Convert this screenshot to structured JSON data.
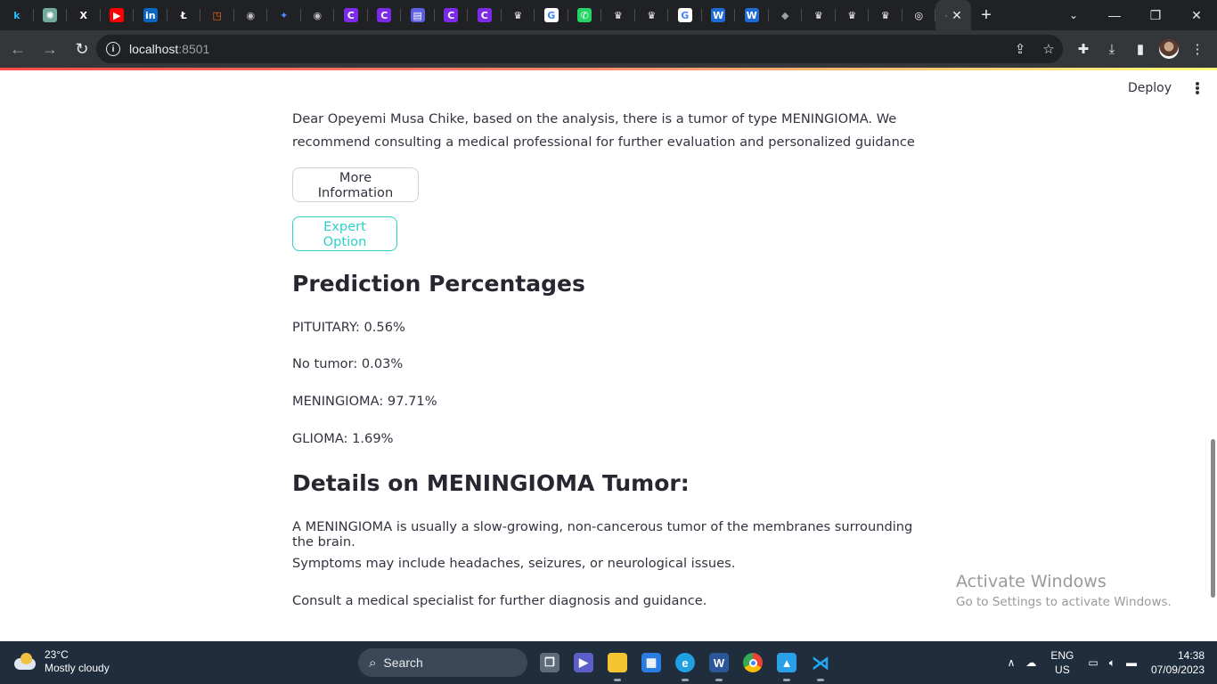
{
  "browser": {
    "tabs": [
      {
        "icon": "kaggle-icon",
        "glyph": "k",
        "color": "#20beff",
        "bg": "transparent"
      },
      {
        "icon": "chatgpt-icon",
        "glyph": "✺",
        "color": "#ffffff",
        "bg": "#74aa9c"
      },
      {
        "icon": "x-icon",
        "glyph": "X",
        "color": "#ffffff",
        "bg": "transparent"
      },
      {
        "icon": "youtube-icon",
        "glyph": "▶",
        "color": "#ffffff",
        "bg": "#ff0000"
      },
      {
        "icon": "linkedin-icon",
        "glyph": "in",
        "color": "#ffffff",
        "bg": "#0a66c2"
      },
      {
        "icon": "upwork-icon",
        "glyph": "Ł",
        "color": "#ffffff",
        "bg": "transparent"
      },
      {
        "icon": "orange-logo-icon",
        "glyph": "◳",
        "color": "#ff6a13",
        "bg": "transparent"
      },
      {
        "icon": "globe-icon",
        "glyph": "◉",
        "color": "#c0c0c0",
        "bg": "transparent"
      },
      {
        "icon": "star-burst-icon",
        "glyph": "✦",
        "color": "#4f8cff",
        "bg": "transparent"
      },
      {
        "icon": "globe-icon",
        "glyph": "◉",
        "color": "#c0c0c0",
        "bg": "transparent"
      },
      {
        "icon": "canva-icon",
        "glyph": "C",
        "color": "#ffffff",
        "bg": "#7d2ae8"
      },
      {
        "icon": "canva-icon",
        "glyph": "C",
        "color": "#ffffff",
        "bg": "#7d2ae8"
      },
      {
        "icon": "app-window-icon",
        "glyph": "▤",
        "color": "#ffffff",
        "bg": "#5b5fe6"
      },
      {
        "icon": "canva-icon",
        "glyph": "C",
        "color": "#ffffff",
        "bg": "#7d2ae8"
      },
      {
        "icon": "canva-icon",
        "glyph": "C",
        "color": "#ffffff",
        "bg": "#7d2ae8"
      },
      {
        "icon": "crown-icon",
        "glyph": "♛",
        "color": "#ffffff",
        "bg": "transparent"
      },
      {
        "icon": "google-icon",
        "glyph": "G",
        "color": "#4285f4",
        "bg": "#ffffff"
      },
      {
        "icon": "whatsapp-icon",
        "glyph": "✆",
        "color": "#ffffff",
        "bg": "#25d366"
      },
      {
        "icon": "crown-icon",
        "glyph": "♛",
        "color": "#ffffff",
        "bg": "transparent"
      },
      {
        "icon": "crown-icon",
        "glyph": "♛",
        "color": "#ffffff",
        "bg": "transparent"
      },
      {
        "icon": "google-icon",
        "glyph": "G",
        "color": "#4285f4",
        "bg": "#ffffff"
      },
      {
        "icon": "webflow-icon",
        "glyph": "W",
        "color": "#ffffff",
        "bg": "#1e6bd6"
      },
      {
        "icon": "webflow-icon",
        "glyph": "W",
        "color": "#ffffff",
        "bg": "#1e6bd6"
      },
      {
        "icon": "layers-icon",
        "glyph": "◆",
        "color": "#9aa0a6",
        "bg": "transparent"
      },
      {
        "icon": "crown-icon",
        "glyph": "♛",
        "color": "#ffffff",
        "bg": "transparent"
      },
      {
        "icon": "crown-icon",
        "glyph": "♛",
        "color": "#ffffff",
        "bg": "transparent"
      },
      {
        "icon": "crown-icon",
        "glyph": "♛",
        "color": "#ffffff",
        "bg": "transparent"
      },
      {
        "icon": "chrome-icon",
        "glyph": "◎",
        "color": "#ffffff",
        "bg": "transparent"
      }
    ],
    "active_tab_glyph": "·",
    "url_host": "localhost",
    "url_port": ":8501"
  },
  "app": {
    "deploy_label": "Deploy",
    "message": "Dear Opeyemi Musa Chike, based on the analysis, there is a tumor of type MENINGIOMA. We recommend consulting a medical professional for further evaluation and personalized guidance",
    "more_info_label": "More Information",
    "expert_option_label": "Expert Option",
    "prediction_heading": "Prediction Percentages",
    "predictions": [
      "PITUITARY: 0.56%",
      "No tumor: 0.03%",
      "MENINGIOMA: 97.71%",
      "GLIOMA: 1.69%"
    ],
    "details_heading": "Details on MENINGIOMA Tumor:",
    "details": [
      "A MENINGIOMA is usually a slow-growing, non-cancerous tumor of the membranes surrounding the brain.",
      "Symptoms may include headaches, seizures, or neurological issues.",
      "Consult a medical specialist for further diagnosis and guidance."
    ],
    "accent_color": "#2ecfc7"
  },
  "watermark": {
    "line1": "Activate Windows",
    "line2": "Go to Settings to activate Windows."
  },
  "taskbar": {
    "temperature": "23°C",
    "weather": "Mostly cloudy",
    "search_label": "Search",
    "lang1": "ENG",
    "lang2": "US",
    "time": "14:38",
    "date": "07/09/2023"
  }
}
